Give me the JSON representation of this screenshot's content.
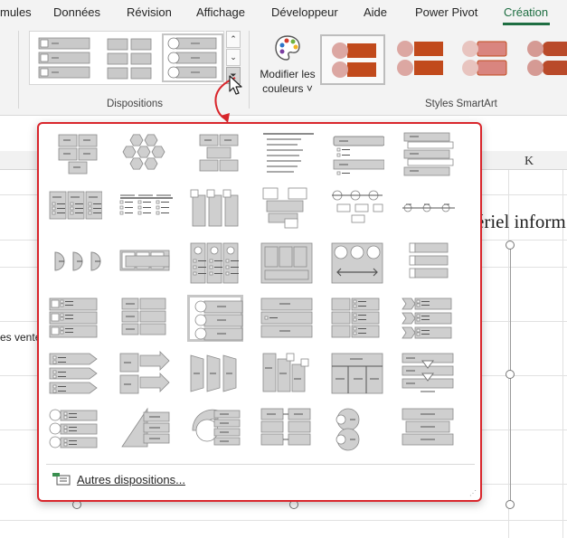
{
  "ribbon": {
    "tabs": [
      "mules",
      "Données",
      "Révision",
      "Affichage",
      "Développeur",
      "Aide",
      "Power Pivot",
      "Création"
    ],
    "active_tab": "Création",
    "groups": {
      "layouts": "Dispositions",
      "styles": "Styles SmartArt"
    },
    "change_colors_label": "Modifier les couleurs",
    "change_colors_line1": "Modifier les",
    "change_colors_line2": "couleurs ˅"
  },
  "sheet": {
    "column_header": "K",
    "title_fragment": "ériel inform",
    "cell_fragment": "es vente"
  },
  "dropdown": {
    "more_layouts_label": "Autres dispositions...",
    "layout_names": [
      "basic-block-list",
      "hexagon-cluster",
      "alternating-blocks",
      "stacked-lines",
      "vertical-bullet-list",
      "vertical-box-list",
      "horizontal-bullet-list",
      "square-accent-list",
      "picture-accent-list",
      "bending-picture-accent",
      "lined-list",
      "vertical-bracket-list",
      "pie-process-list",
      "trapezoid-list",
      "tab-list",
      "table-list",
      "segmented-list",
      "vertical-picture-list",
      "stacked-list",
      "vertical-block-list",
      "vertical-circle-list",
      "grouped-list",
      "pyramid-list",
      "vertical-chevron-list",
      "horizontal-arrow-list",
      "target-list",
      "trapezoid-arrows",
      "descending-blocks",
      "table-hierarchy",
      "stacked-arrows",
      "circle-bullet-list",
      "pyramid-list-2",
      "arc-list",
      "linked-boxes",
      "circle-pair-list",
      "block-hierarchy"
    ]
  },
  "colors": {
    "accent": "#1e6e42",
    "highlight": "#d9262c",
    "style_orange": "#c14a1c",
    "style_pink": "#dca7a2"
  }
}
